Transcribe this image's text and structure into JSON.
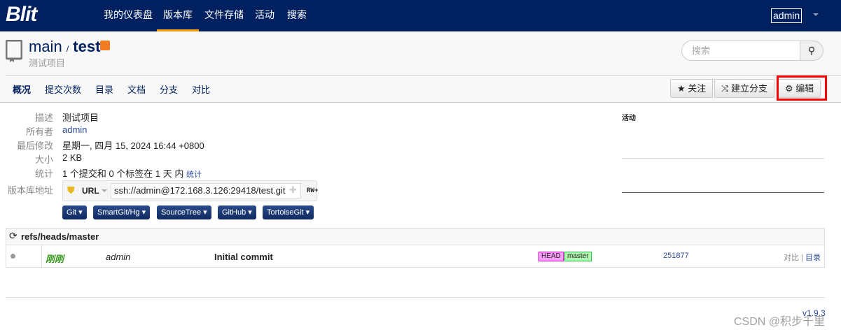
{
  "nav": {
    "logo": "Blit",
    "items": [
      "我的仪表盘",
      "版本库",
      "文件存储",
      "活动",
      "搜索"
    ],
    "user": "admin"
  },
  "repo": {
    "project": "main",
    "sep": "/",
    "name": "test",
    "description": "测试项目"
  },
  "search": {
    "placeholder": "搜索"
  },
  "tabs": [
    "概况",
    "提交次数",
    "目录",
    "文档",
    "分支",
    "对比"
  ],
  "actions": {
    "watch": "关注",
    "fork": "建立分支",
    "edit": "编辑"
  },
  "info": {
    "desc_label": "描述",
    "desc": "测试项目",
    "owner_label": "所有者",
    "owner": "admin",
    "modified_label": "最后修改",
    "modified": "星期一, 四月 15, 2024 16:44 +0800",
    "size_label": "大小",
    "size": "2 KB",
    "stats_label": "统计",
    "stats": "1 个提交和 0 个标签在 1 天 内",
    "stats_link": "统计",
    "url_label": "版本库地址",
    "url_type": "URL",
    "url": "ssh://admin@172.168.3.126:29418/test.git",
    "perm": "RW+"
  },
  "clients": [
    "Git",
    "SmartGit/Hg",
    "SourceTree",
    "GitHub",
    "TortoiseGit"
  ],
  "activity": {
    "title": "活动"
  },
  "branch": {
    "ref": "refs/heads/master",
    "commit": {
      "when": "刚刚",
      "author": "admin",
      "message": "Initial commit",
      "tags": [
        "HEAD",
        "master"
      ],
      "id": "251877",
      "compare": "对比",
      "sep": "|",
      "tree": "目录"
    }
  },
  "footer": {
    "version": "v1.9.3",
    "watermark": "CSDN @积步千里"
  }
}
